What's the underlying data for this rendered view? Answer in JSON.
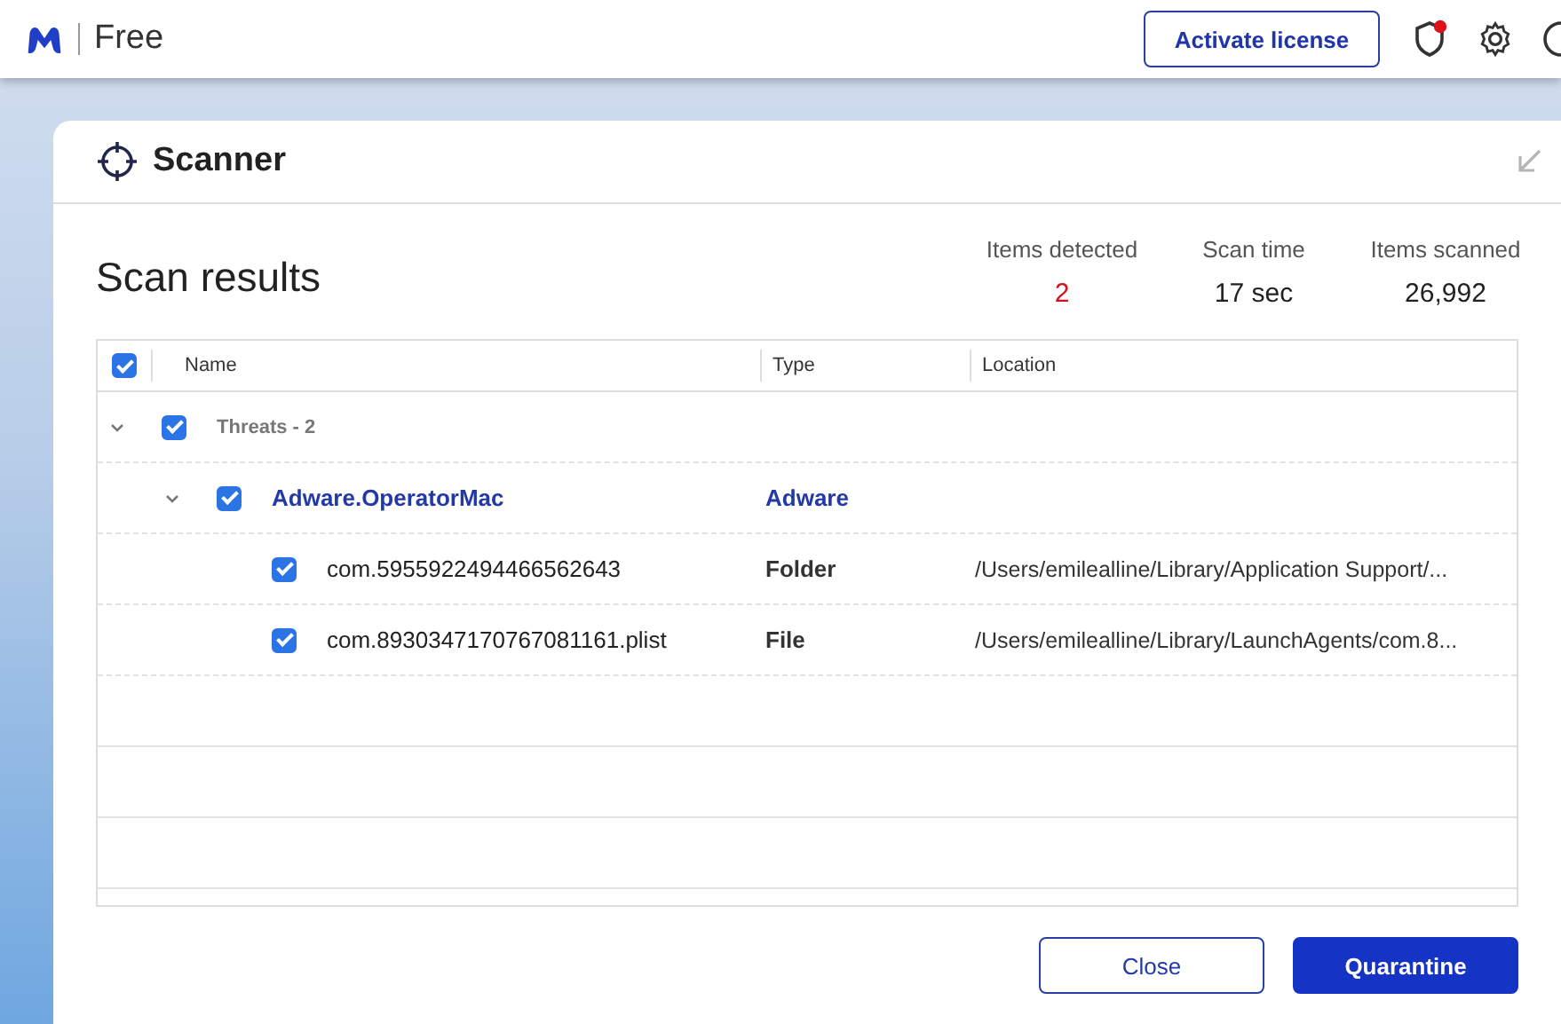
{
  "topbar": {
    "product": "Free",
    "activate_button": "Activate license",
    "shield_alert": true
  },
  "scanner": {
    "title": "Scanner",
    "heading": "Scan results",
    "stats": [
      {
        "label": "Items detected",
        "value": "2",
        "alert": true
      },
      {
        "label": "Scan time",
        "value": "17 sec",
        "alert": false
      },
      {
        "label": "Items scanned",
        "value": "26,992",
        "alert": false
      }
    ],
    "table": {
      "all_checked": true,
      "columns": [
        "Name",
        "Type",
        "Location"
      ],
      "rows": [
        {
          "kind": "group",
          "name": "Threats - 2",
          "checked": true,
          "expanded": true,
          "children": [
            {
              "kind": "threat",
              "name": "Adware.OperatorMac",
              "type": "Adware",
              "checked": true,
              "expanded": true,
              "children": [
                {
                  "kind": "file",
                  "name": "com.5955922494466562643",
                  "type": "Folder",
                  "location": "/Users/emilealline/Library/Application Support/...",
                  "checked": true
                },
                {
                  "kind": "file",
                  "name": "com.8930347170767081161.plist",
                  "type": "File",
                  "location": "/Users/emilealline/Library/LaunchAgents/com.8...",
                  "checked": true
                }
              ]
            }
          ]
        }
      ]
    },
    "buttons": [
      {
        "label": "Close",
        "kind": "secondary"
      },
      {
        "label": "Quarantine",
        "kind": "primary"
      }
    ]
  }
}
